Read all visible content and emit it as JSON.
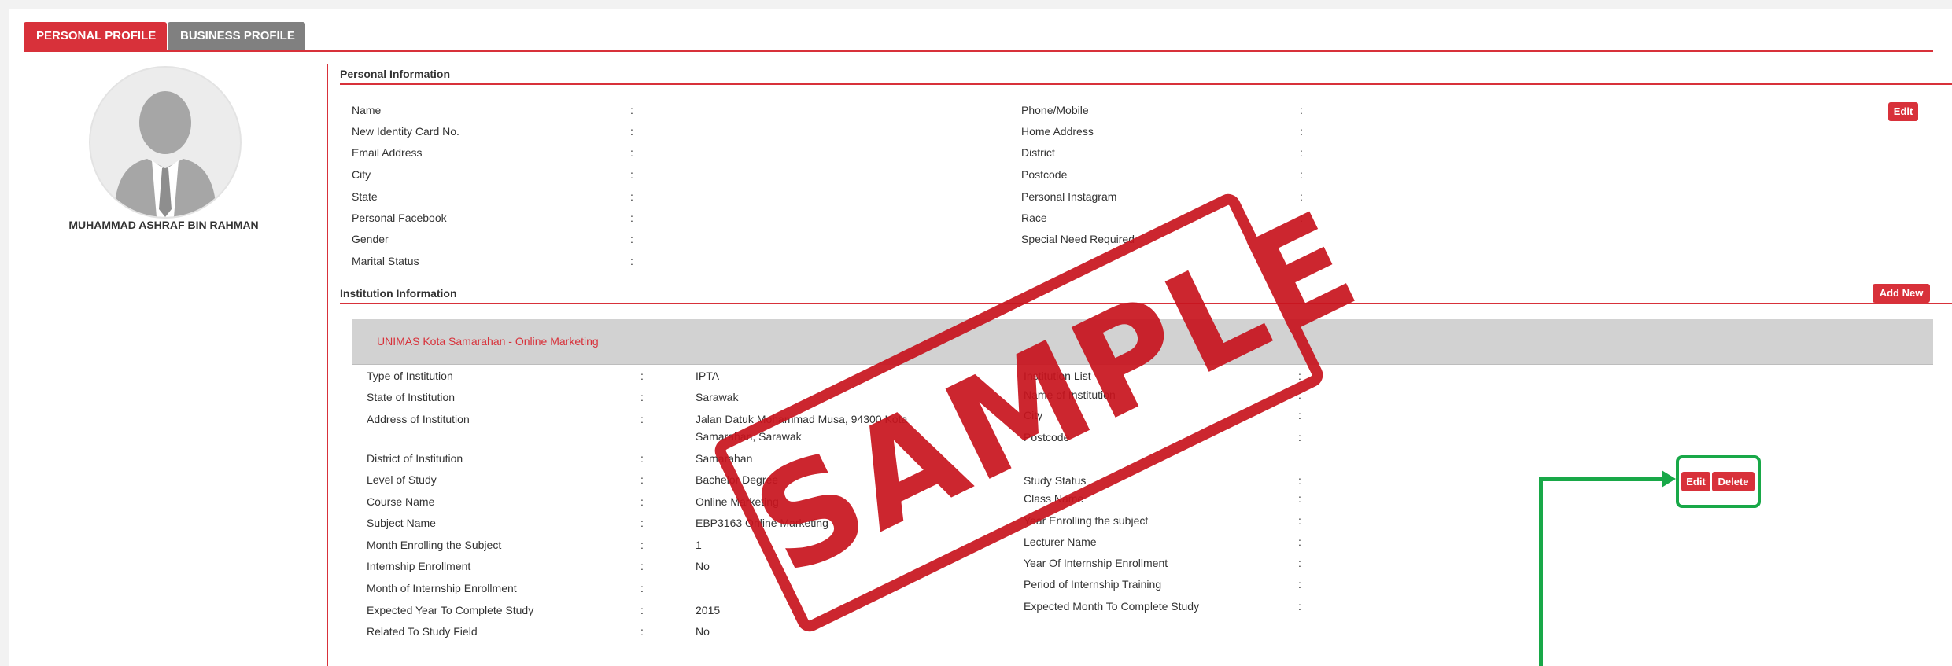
{
  "tabs": {
    "personal": "PERSONAL PROFILE",
    "business": "BUSINESS PROFILE"
  },
  "profile": {
    "name": "MUHAMMAD ASHRAF BIN RAHMAN",
    "avatar_icon": "user-silhouette-icon"
  },
  "personal": {
    "title": "Personal Information",
    "edit_label": "Edit",
    "left_fields": [
      {
        "label": "Name",
        "value": ""
      },
      {
        "label": "New Identity Card No.",
        "value": ""
      },
      {
        "label": "Email Address",
        "value": ""
      },
      {
        "label": "City",
        "value": ""
      },
      {
        "label": "State",
        "value": ""
      },
      {
        "label": "Personal Facebook",
        "value": ""
      },
      {
        "label": "Gender",
        "value": ""
      },
      {
        "label": "Marital Status",
        "value": ""
      }
    ],
    "right_fields": [
      {
        "label": "Phone/Mobile",
        "value": ""
      },
      {
        "label": "Home Address",
        "value": ""
      },
      {
        "label": "District",
        "value": ""
      },
      {
        "label": "Postcode",
        "value": ""
      },
      {
        "label": "Personal Instagram",
        "value": ""
      },
      {
        "label": "Race",
        "value": ""
      },
      {
        "label": "Special Need Required",
        "value": ""
      }
    ]
  },
  "institution": {
    "title": "Institution Information",
    "add_new_label": "Add New",
    "item_title": "UNIMAS Kota Samarahan - Online Marketing",
    "edit_label": "Edit",
    "delete_label": "Delete",
    "left_fields": [
      {
        "label": "Type of Institution",
        "value": "IPTA"
      },
      {
        "label": "State of Institution",
        "value": "Sarawak"
      },
      {
        "label": "Address of Institution",
        "value": "Jalan Datuk Mohammad Musa, 94300 Kota",
        "value2": "Samarahan, Sarawak"
      },
      {
        "label": "District of Institution",
        "value": "Samarahan"
      },
      {
        "label": "Level of Study",
        "value": "Bachelor Degree"
      },
      {
        "label": "Course Name",
        "value": "Online Marketing"
      },
      {
        "label": "Subject Name",
        "value": "EBP3163 Online Marketing"
      },
      {
        "label": "Month Enrolling the Subject",
        "value": "1"
      },
      {
        "label": "Internship Enrollment",
        "value": "No"
      },
      {
        "label": "Month of Internship Enrollment",
        "value": ""
      },
      {
        "label": "Expected Year To Complete Study",
        "value": "2015"
      },
      {
        "label": "Related To Study Field",
        "value": "No"
      }
    ],
    "right_fields": [
      {
        "label": "Institution List",
        "value": ""
      },
      {
        "label": "Name of Institution",
        "value": ""
      },
      {
        "label": "City",
        "value": ""
      },
      {
        "label": "Postcode",
        "value": ""
      },
      {
        "label": "Study Status",
        "value": ""
      },
      {
        "label": "Class Name",
        "value": ""
      },
      {
        "label": "Year Enrolling the subject",
        "value": ""
      },
      {
        "label": "Lecturer Name",
        "value": ""
      },
      {
        "label": "Year Of Internship Enrollment",
        "value": ""
      },
      {
        "label": "Period of Internship Training",
        "value": ""
      },
      {
        "label": "Expected Month To Complete Study",
        "value": ""
      }
    ]
  },
  "watermark": {
    "text": "SAMPLE",
    "color": "#c8141e"
  },
  "colors": {
    "accent": "#d8313a",
    "tab_inactive": "#808080",
    "highlight": "#18a848",
    "header_band": "#d2d2d2"
  }
}
